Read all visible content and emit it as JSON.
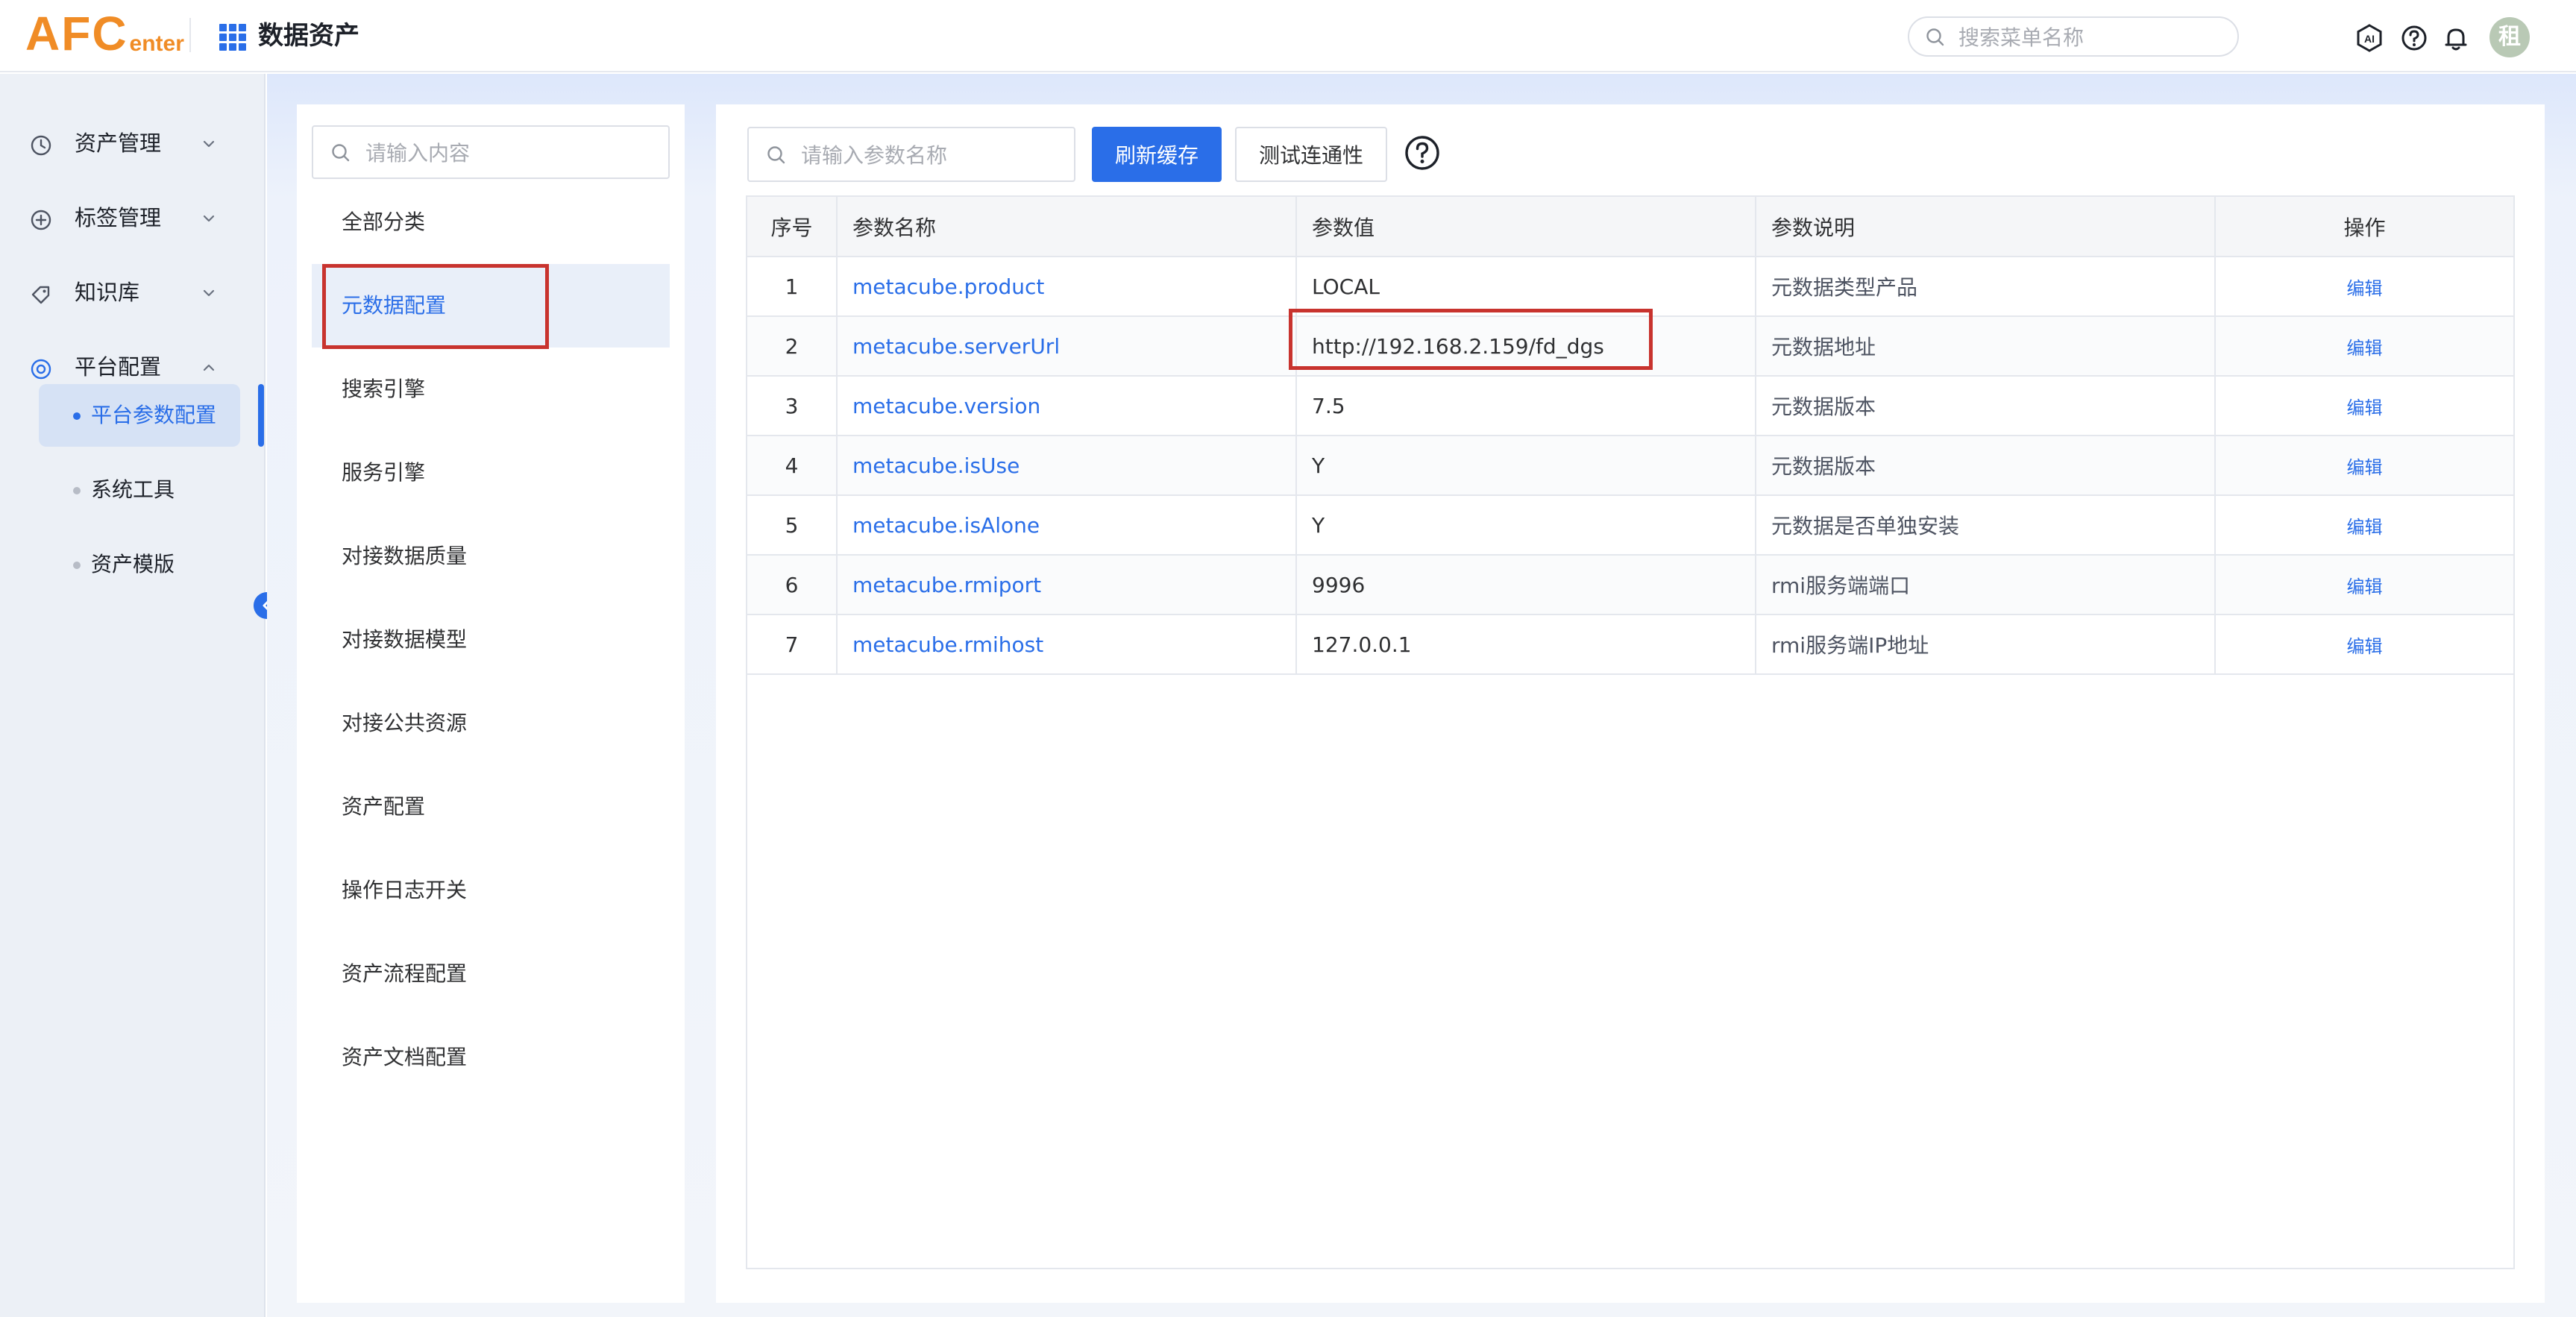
{
  "header": {
    "logo_big": "AFC",
    "logo_small": "enter",
    "app_title": "数据资产",
    "menu_search_placeholder": "搜索菜单名称",
    "avatar_text": "租",
    "icons": [
      "ai-icon",
      "help-icon",
      "bell-icon"
    ]
  },
  "sidebar": {
    "items": [
      {
        "label": "资产管理",
        "icon": "clock-icon",
        "expanded": false
      },
      {
        "label": "标签管理",
        "icon": "plus-circle-icon",
        "expanded": false
      },
      {
        "label": "知识库",
        "icon": "tag-icon",
        "expanded": false
      },
      {
        "label": "平台配置",
        "icon": "settings-icon",
        "expanded": true
      }
    ],
    "sub_items": [
      {
        "label": "平台参数配置",
        "active": true
      },
      {
        "label": "系统工具",
        "active": false
      },
      {
        "label": "资产模版",
        "active": false
      }
    ]
  },
  "category_panel": {
    "search_placeholder": "请输入内容",
    "items": [
      {
        "label": "全部分类"
      },
      {
        "label": "元数据配置",
        "active": true
      },
      {
        "label": "搜索引擎"
      },
      {
        "label": "服务引擎"
      },
      {
        "label": "对接数据质量"
      },
      {
        "label": "对接数据模型"
      },
      {
        "label": "对接公共资源"
      },
      {
        "label": "资产配置"
      },
      {
        "label": "操作日志开关"
      },
      {
        "label": "资产流程配置"
      },
      {
        "label": "资产文档配置"
      }
    ]
  },
  "toolbar": {
    "search_placeholder": "请输入参数名称",
    "refresh_label": "刷新缓存",
    "test_label": "测试连通性",
    "help_icon": "question-circle-icon"
  },
  "table": {
    "columns": [
      "序号",
      "参数名称",
      "参数值",
      "参数说明",
      "操作"
    ],
    "rows": [
      {
        "idx": "1",
        "name": "metacube.product",
        "value": "LOCAL",
        "desc": "元数据类型产品",
        "action": "编辑"
      },
      {
        "idx": "2",
        "name": "metacube.serverUrl",
        "value": "http://192.168.2.159/fd_dgs",
        "desc": "元数据地址",
        "action": "编辑"
      },
      {
        "idx": "3",
        "name": "metacube.version",
        "value": "7.5",
        "desc": "元数据版本",
        "action": "编辑"
      },
      {
        "idx": "4",
        "name": "metacube.isUse",
        "value": "Y",
        "desc": "元数据版本",
        "action": "编辑"
      },
      {
        "idx": "5",
        "name": "metacube.isAlone",
        "value": "Y",
        "desc": "元数据是否单独安装",
        "action": "编辑"
      },
      {
        "idx": "6",
        "name": "metacube.rmiport",
        "value": "9996",
        "desc": "rmi服务端端口",
        "action": "编辑"
      },
      {
        "idx": "7",
        "name": "metacube.rmihost",
        "value": "127.0.0.1",
        "desc": "rmi服务端IP地址",
        "action": "编辑"
      }
    ]
  },
  "colors": {
    "accent": "#2a6ee8",
    "brand": "#f08c26",
    "highlight_box": "#c8332e"
  }
}
